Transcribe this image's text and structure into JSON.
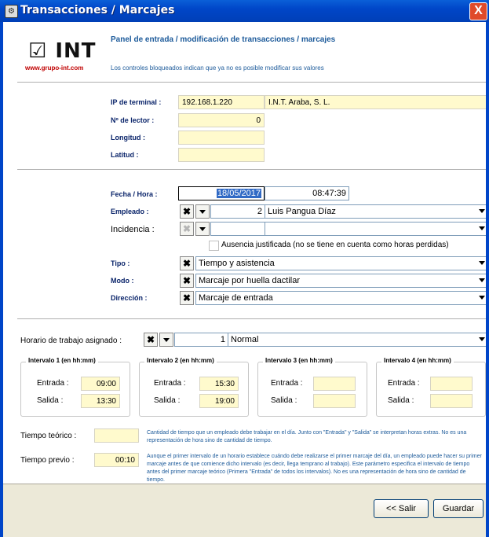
{
  "window": {
    "title": "Transacciones / Marcajes",
    "close_glyph": "X",
    "app_icon_glyph": "⚙"
  },
  "logo": {
    "mark": "☑ INT",
    "url": "www.grupo-int.com"
  },
  "header": {
    "title": "Panel de entrada / modificación de transacciones / marcajes",
    "subtitle": "Los controles bloqueados indican que ya no es posible modificar sus valores"
  },
  "terminal": {
    "ip_label": "IP de terminal :",
    "ip_value": "192.168.1.220",
    "ip_name": "I.N.T. Araba, S. L.",
    "reader_label": "Nº de lector :",
    "reader_value": "0",
    "longitude_label": "Longitud :",
    "longitude_value": "",
    "latitude_label": "Latitud :",
    "latitude_value": ""
  },
  "transaction": {
    "datetime_label": "Fecha / Hora :",
    "date_value": "18/05/2017",
    "time_value": "08:47:39",
    "employee_label": "Empleado :",
    "employee_id": "2",
    "employee_name": "Luis Pangua Díaz",
    "incidence_label": "Incidencia :",
    "incidence_id": "",
    "incidence_name": "",
    "justified_absence_label": "Ausencia justificada (no se tiene en cuenta como horas perdidas)",
    "type_label": "Tipo :",
    "type_value": "Tiempo y asistencia",
    "mode_label": "Modo :",
    "mode_value": "Marcaje por huella dactilar",
    "direction_label": "Dirección :",
    "direction_value": "Marcaje de entrada"
  },
  "schedule": {
    "assigned_label": "Horario de trabajo asignado :",
    "schedule_id": "1",
    "schedule_name": "Normal",
    "intervals": [
      {
        "legend": "Intervalo 1 (en hh:mm)",
        "entry_label": "Entrada :",
        "entry_value": "09:00",
        "exit_label": "Salida :",
        "exit_value": "13:30"
      },
      {
        "legend": "Intervalo 2 (en hh:mm)",
        "entry_label": "Entrada :",
        "entry_value": "15:30",
        "exit_label": "Salida :",
        "exit_value": "19:00"
      },
      {
        "legend": "Intervalo 3 (en hh:mm)",
        "entry_label": "Entrada :",
        "entry_value": "",
        "exit_label": "Salida :",
        "exit_value": ""
      },
      {
        "legend": "Intervalo 4 (en hh:mm)",
        "entry_label": "Entrada :",
        "entry_value": "",
        "exit_label": "Salida :",
        "exit_value": ""
      }
    ],
    "theoretical_label": "Tiempo teórico :",
    "theoretical_value": "",
    "theoretical_help": "Cantidad de tiempo que un empleado debe trabajar en el día. Junto con \"Entrada\" y \"Salida\" se interpretan horas extras. No es una representación de hora sino de cantidad de tiempo.",
    "previous_label": "Tiempo previo :",
    "previous_value": "00:10",
    "previous_help": "Aunque el primer intervalo de un horario establece cuándo debe realizarse el primer marcaje del día, un empleado puede hacer su primer marcaje antes de que comience dicho intervalo (es decir, llega temprano al trabajo). Este parámetro especifica el intervalo de tiempo antes del primer marcaje teórico (Primera \"Entrada\" de todos los intervalos). No es una representación de hora sino de cantidad de tiempo."
  },
  "buttons": {
    "exit": "<< Salir",
    "save": "Guardar",
    "clear_glyph": "✖"
  }
}
